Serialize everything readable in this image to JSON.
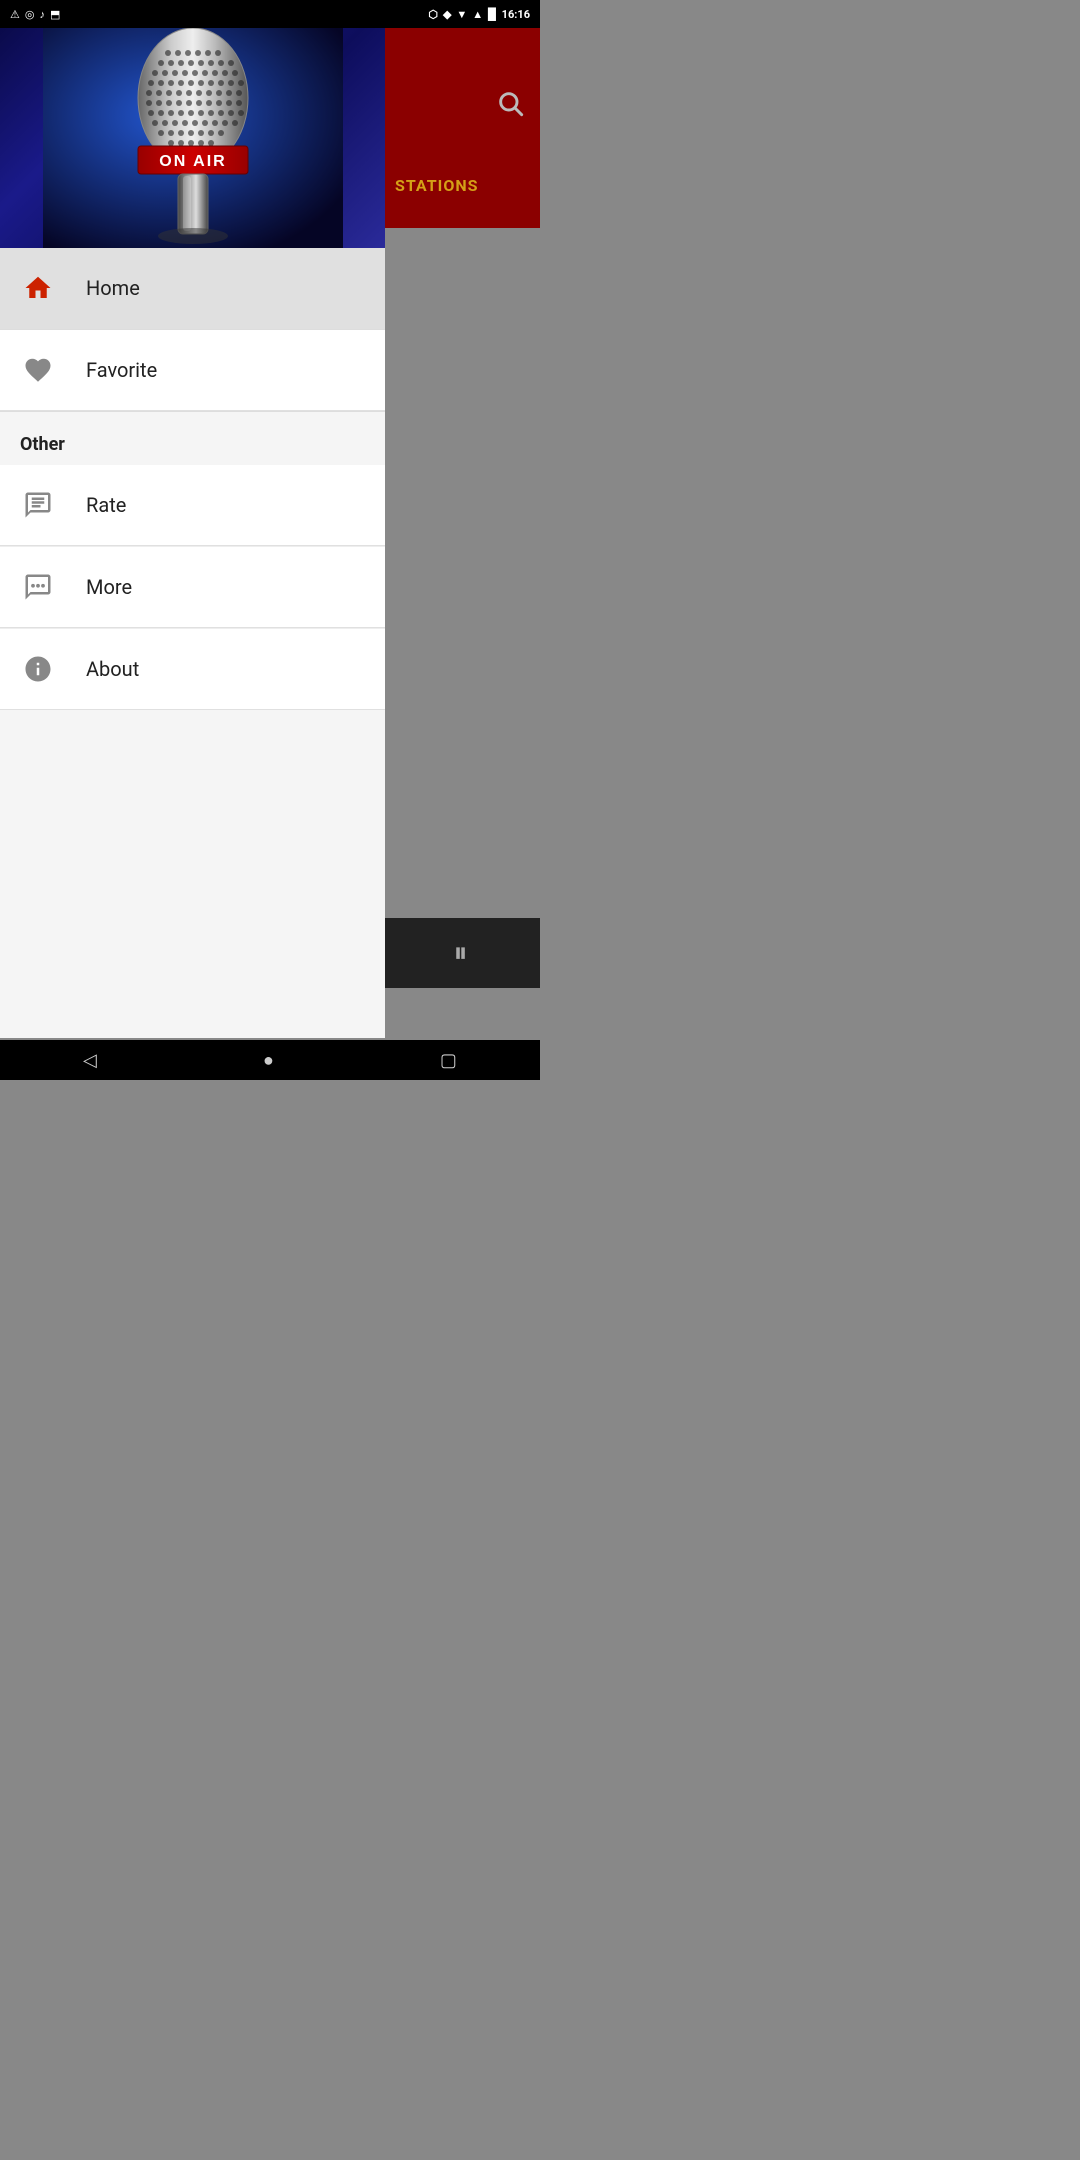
{
  "statusBar": {
    "time": "16:16",
    "leftIcons": [
      "⚠",
      "◎",
      "♪",
      "⬒"
    ],
    "rightIcons": [
      "⬡",
      "◆",
      "▼",
      "▲",
      "▉"
    ]
  },
  "rightPanel": {
    "searchIconLabel": "search-icon",
    "stationsLabel": "STATIONS"
  },
  "hero": {
    "altText": "On Air Microphone"
  },
  "menu": {
    "homeLabel": "Home",
    "favoriteLabel": "Favorite",
    "otherSectionLabel": "Other",
    "rateLabel": "Rate",
    "moreLabel": "More",
    "aboutLabel": "About"
  },
  "playBar": {
    "pauseSymbol": "⏸"
  },
  "navBar": {
    "backLabel": "◁",
    "homeLabel": "●",
    "recentLabel": "▢"
  }
}
